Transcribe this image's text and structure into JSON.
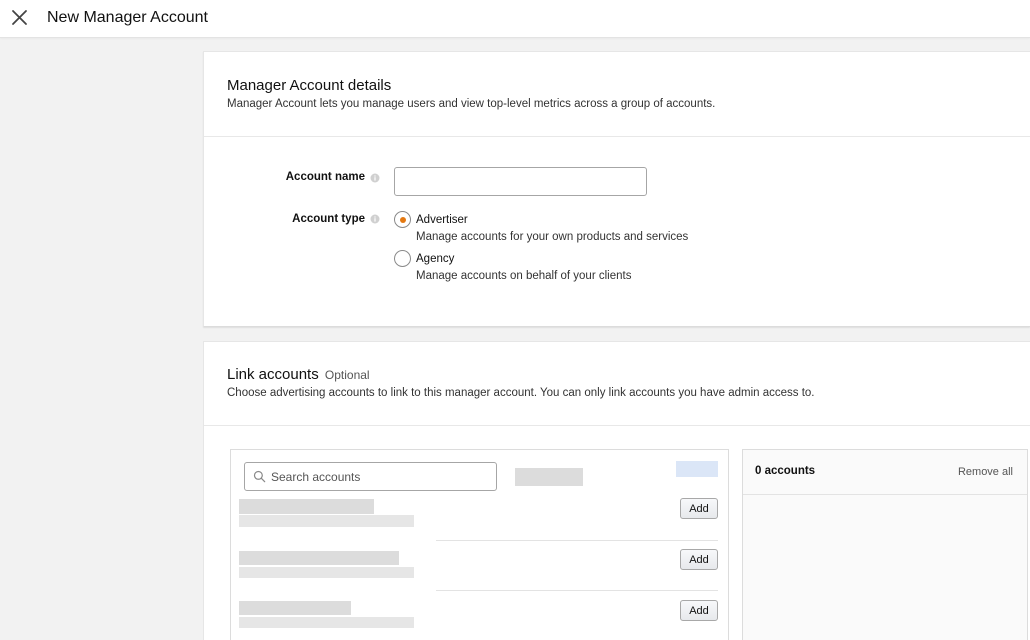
{
  "header": {
    "title": "New Manager Account",
    "close_icon": "close-icon"
  },
  "details": {
    "title": "Manager Account details",
    "description": "Manager Account lets you manage users and view top-level metrics across a group of accounts.",
    "account_name": {
      "label": "Account name",
      "value": "",
      "info_icon": "info-icon"
    },
    "account_type": {
      "label": "Account type",
      "info_icon": "info-icon",
      "selected": "Advertiser",
      "options": [
        {
          "label": "Advertiser",
          "description": "Manage accounts for your own products and services",
          "checked": true
        },
        {
          "label": "Agency",
          "description": "Manage accounts on behalf of your clients",
          "checked": false
        }
      ]
    }
  },
  "link": {
    "title": "Link accounts",
    "optional": "Optional",
    "description": "Choose advertising accounts to link to this manager account. You can only link accounts you have admin access to.",
    "search": {
      "placeholder": "Search accounts",
      "value": "",
      "icon": "search-icon"
    },
    "rows": [
      {
        "add_label": "Add"
      },
      {
        "add_label": "Add"
      },
      {
        "add_label": "Add"
      }
    ],
    "selected": {
      "count_label": "0 accounts",
      "remove_all": "Remove all"
    }
  },
  "colors": {
    "radio_selected": "#e47911",
    "page_background": "#f2f2f2"
  }
}
